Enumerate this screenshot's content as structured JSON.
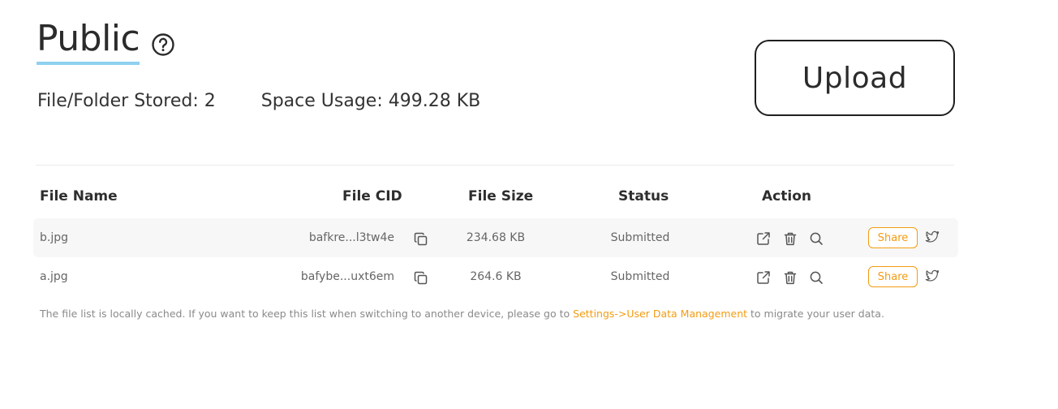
{
  "header": {
    "title": "Public",
    "help_icon": "question-circle-icon",
    "upload_label": "Upload"
  },
  "stats": {
    "files_label": "File/Folder Stored:",
    "files_value": "2",
    "space_label": "Space Usage:",
    "space_value": "499.28 KB"
  },
  "table": {
    "columns": [
      "File Name",
      "File CID",
      "File Size",
      "Status",
      "Action"
    ],
    "rows": [
      {
        "name": "b.jpg",
        "cid": "bafkre...l3tw4e",
        "size": "234.68 KB",
        "status": "Submitted",
        "share_label": "Share"
      },
      {
        "name": "a.jpg",
        "cid": "bafybe...uxt6em",
        "size": "264.6 KB",
        "status": "Submitted",
        "share_label": "Share"
      }
    ]
  },
  "footnote": {
    "before": "The file list is locally cached. If you want to keep this list when switching to another device, please go to ",
    "link": "Settings->User Data Management",
    "after": " to migrate your user data."
  },
  "colors": {
    "accent": "#f39c12",
    "title_underline": "#8ed0ef",
    "row_shade": "#f7f7f7"
  },
  "icons": {
    "copy": "copy-icon",
    "open": "external-link-icon",
    "delete": "trash-icon",
    "search": "search-icon",
    "twitter": "twitter-icon"
  }
}
